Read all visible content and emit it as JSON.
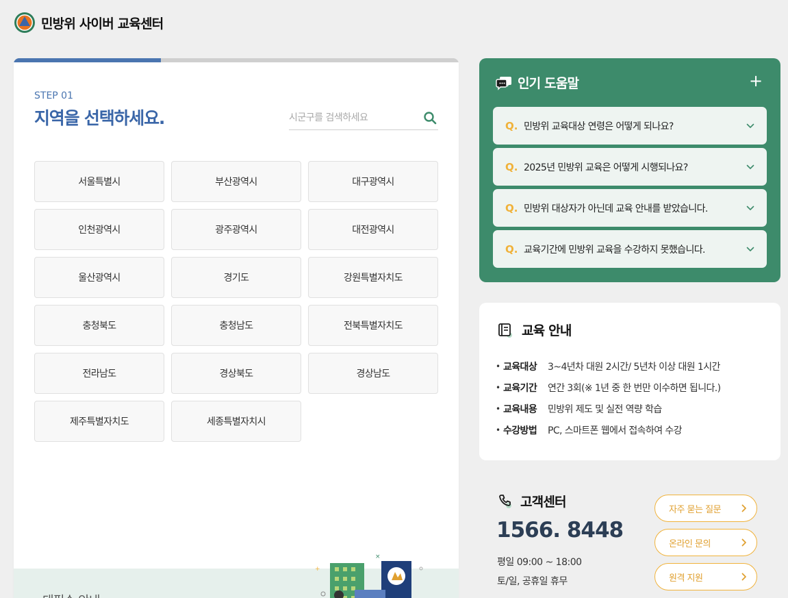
{
  "app": {
    "title": "민방위 사이버 교육센터"
  },
  "colors": {
    "primary": "#4a75b0",
    "green": "#3d8b6b",
    "accent": "#f0b23a",
    "logo_orange": "#e8731e"
  },
  "step": {
    "label": "STEP 01",
    "title": "지역을 선택하세요.",
    "progress": 0.33
  },
  "search": {
    "placeholder": "시군구를 검색하세요",
    "value": ""
  },
  "regions": [
    "서울특별시",
    "부산광역시",
    "대구광역시",
    "인천광역시",
    "광주광역시",
    "대전광역시",
    "울산광역시",
    "경기도",
    "강원특별자치도",
    "충청북도",
    "충청남도",
    "전북특별자치도",
    "전라남도",
    "경상북도",
    "경상남도",
    "제주특별자치도",
    "세종특별자치시"
  ],
  "bottom_band": {
    "text": "태필수 안내"
  },
  "help": {
    "title": "인기 도움말",
    "expand_label": "+",
    "q_marker": "Q.",
    "items": [
      "민방위 교육대상 연령은 어떻게 되나요?",
      "2025년 민방위 교육은 어떻게 시행되나요?",
      "민방위 대상자가 아닌데 교육 안내를 받았습니다.",
      "교육기간에 민방위 교육을 수강하지 못했습니다."
    ]
  },
  "edu": {
    "title": "교육 안내",
    "bullet": "•",
    "items": [
      {
        "key": "교육대상",
        "value": "3~4년차 대원 2시간/ 5년차 이상 대원 1시간"
      },
      {
        "key": "교육기간",
        "value": "연간 3회(※ 1년 중 한 번만 이수하면 됩니다.)"
      },
      {
        "key": "교육내용",
        "value": "민방위 제도 및 실전 역량 학습"
      },
      {
        "key": "수강방법",
        "value": "PC, 스마트폰 웹에서 접속하여 수강"
      }
    ]
  },
  "customer_center": {
    "title": "고객센터",
    "phone": "1566. 8448",
    "weekday_hours": "평일 09:00 ~ 18:00",
    "weekend_hours": "토/일, 공휴일 휴무",
    "buttons": [
      "자주 묻는 질문",
      "온라인 문의",
      "원격 지원"
    ]
  },
  "icons": {
    "logo": "civil-defense-logo",
    "search": "search-icon",
    "help": "chat-bubble-icon",
    "edu": "book-icon",
    "phone": "phone-icon",
    "chevron_down": "chevron-down-icon",
    "chevron_right": "chevron-right-icon"
  }
}
